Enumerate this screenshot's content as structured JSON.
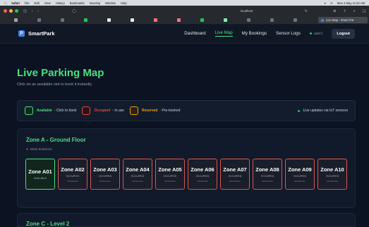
{
  "menubar": {
    "app": "Safari",
    "items": [
      "File",
      "Edit",
      "View",
      "History",
      "Bookmarks",
      "Develop",
      "Window",
      "Help"
    ],
    "datetime": "Mon 4 May 11:52 AM"
  },
  "browser": {
    "address": "localhost",
    "active_tab": "Live Map - Smart Par",
    "favicons": [
      "#9ca3af",
      "#6b7280",
      "#6b7280",
      "#22c55e",
      "#e5e7eb",
      "#e5e7eb",
      "#f87171",
      "#fb7185",
      "#22c55e",
      "#86efac",
      "#6b7280",
      "#6b7280",
      "#6b7280"
    ]
  },
  "nav": {
    "brand": "SmartPark",
    "links": [
      "Dashboard",
      "Live Map",
      "My Bookings",
      "Sensor Logs"
    ],
    "active": "Live Map",
    "user": "user1",
    "logout": "Logout"
  },
  "page": {
    "title": "Live Parking Map",
    "subtitle": "Click on an available slot to book it instantly"
  },
  "legend": {
    "items": [
      {
        "label": "Available",
        "desc": "- Click to book",
        "color": "#4ade80"
      },
      {
        "label": "Occupied",
        "desc": "- In use",
        "color": "#ef4444"
      },
      {
        "label": "Reserved",
        "desc": "- Pre-booked",
        "color": "#f59e0b"
      }
    ],
    "live": "Live updates via IoT sensors"
  },
  "zones": [
    {
      "title": "Zone A - Ground Floor",
      "location": "Main Entrance",
      "slots": [
        {
          "name": "Zone A01",
          "status": "AVAILABLE",
          "sub": ""
        },
        {
          "name": "Zone A02",
          "status": "OCCUPIED",
          "sub": "RESERVED"
        },
        {
          "name": "Zone A03",
          "status": "OCCUPIED",
          "sub": "RESERVED"
        },
        {
          "name": "Zone A04",
          "status": "OCCUPIED",
          "sub": "RESERVED"
        },
        {
          "name": "Zone A05",
          "status": "OCCUPIED",
          "sub": "RESERVED"
        },
        {
          "name": "Zone A06",
          "status": "OCCUPIED",
          "sub": "RESERVED"
        },
        {
          "name": "Zone A07",
          "status": "OCCUPIED",
          "sub": "RESERVED"
        },
        {
          "name": "Zone A08",
          "status": "OCCUPIED",
          "sub": "RESERVED"
        },
        {
          "name": "Zone A09",
          "status": "OCCUPIED",
          "sub": "RESERVED"
        },
        {
          "name": "Zone A10",
          "status": "OCCUPIED",
          "sub": "RESERVED"
        }
      ]
    },
    {
      "title": "Zone C - Level 2"
    }
  ]
}
